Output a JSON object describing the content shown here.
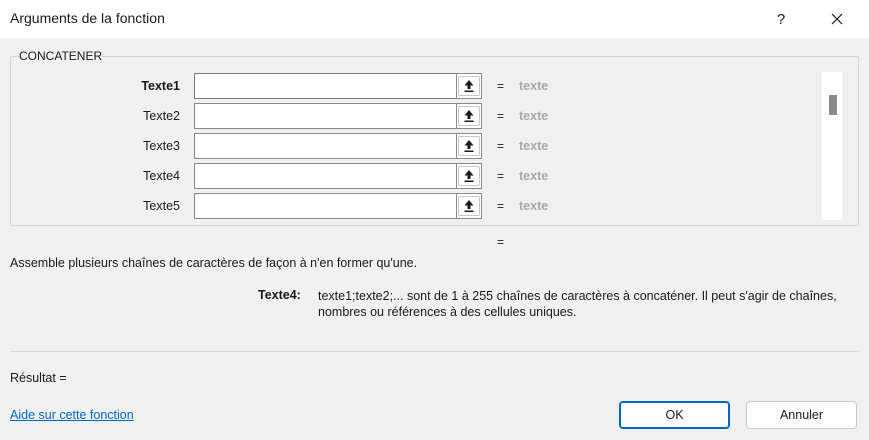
{
  "window": {
    "title": "Arguments de la fonction",
    "help_glyph": "?"
  },
  "function_name": "CONCATENER",
  "arguments": [
    {
      "label": "Texte1",
      "value": "",
      "equals": "=",
      "result": "texte",
      "active": true
    },
    {
      "label": "Texte2",
      "value": "",
      "equals": "=",
      "result": "texte",
      "active": false
    },
    {
      "label": "Texte3",
      "value": "",
      "equals": "=",
      "result": "texte",
      "active": false
    },
    {
      "label": "Texte4",
      "value": "",
      "equals": "=",
      "result": "texte",
      "active": false
    },
    {
      "label": "Texte5",
      "value": "",
      "equals": "=",
      "result": "texte",
      "active": false
    }
  ],
  "formula_result_equals": "=",
  "description": "Assemble plusieurs chaînes de caractères de façon à n'en former qu'une.",
  "argument_help": {
    "name": "Texte4:",
    "text": "texte1;texte2;... sont de 1 à 255 chaînes de caractères à concaténer. Il peut s'agir de chaînes, nombres ou références à des cellules uniques."
  },
  "result_label": "Résultat =",
  "help_link": "Aide sur cette fonction",
  "buttons": {
    "ok": "OK",
    "cancel": "Annuler"
  },
  "icons": {
    "help": "question-mark-icon",
    "close": "close-icon",
    "collapse": "collapse-dialog-arrow-icon"
  },
  "colors": {
    "link": "#0066cc",
    "ok_border": "#0067c0",
    "placeholder_value": "#a8a8a8"
  }
}
